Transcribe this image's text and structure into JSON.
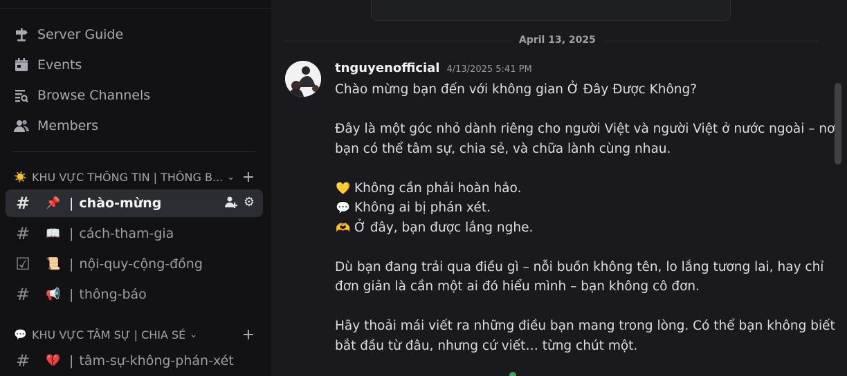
{
  "sidebar": {
    "nav": [
      {
        "label": "Server Guide",
        "icon": "signpost-icon"
      },
      {
        "label": "Events",
        "icon": "calendar-icon"
      },
      {
        "label": "Browse Channels",
        "icon": "browse-channels-icon"
      },
      {
        "label": "Members",
        "icon": "members-icon"
      }
    ],
    "categories": [
      {
        "emoji": "☀️",
        "title": "KHU VỰC THÔNG TIN | THÔNG B..."
      },
      {
        "emoji": "💬",
        "title": "KHU VỰC TÂM SỰ | CHIA SẺ"
      }
    ],
    "channels": [
      {
        "icon": "#",
        "emoji": "📌",
        "name": "chào-mừng",
        "active": true
      },
      {
        "icon": "#",
        "emoji": "📖",
        "name": "cách-tham-gia",
        "active": false
      },
      {
        "icon": "☑",
        "emoji": "📜",
        "name": "nội-quy-cộng-đồng",
        "active": false
      },
      {
        "icon": "#",
        "emoji": "📢",
        "name": "thông-báo",
        "active": false
      },
      {
        "icon": "#",
        "emoji": "💔",
        "name": "tâm-sự-không-phán-xét",
        "active": false
      }
    ]
  },
  "main": {
    "date_divider": "April 13, 2025",
    "message": {
      "username": "tnguyenofficial",
      "timestamp": "4/13/2025 5:41 PM",
      "lines": [
        "Chào mừng bạn đến với không gian Ở Đây Được Không?",
        "",
        "Đây là một góc nhỏ dành riêng cho người Việt và người Việt ở nước ngoài – nơi",
        "bạn có thể tâm sự, chia sẻ, và chữa lành cùng nhau.",
        "",
        "Không cần phải hoàn hảo.",
        "Không ai bị phán xét.",
        "Ở đây, bạn được lắng nghe.",
        "",
        "Dù bạn đang trải qua điều gì – nỗi buồn không tên, lo lắng tương lai, hay chỉ",
        "đơn giản là cần một ai đó hiểu mình – bạn không cô đơn.",
        "",
        "Hãy thoải mái viết ra những điều bạn mang trong lòng. Có thể bạn không biết",
        "bắt đầu từ đâu, nhưng cứ viết… từng chút một."
      ],
      "line_emojis": {
        "5": "💛",
        "6": "💬",
        "7": "🫶"
      }
    }
  },
  "colors": {
    "sidebar_bg": "#121214",
    "main_bg": "#1a1a1e",
    "active_bg": "#2c2d32"
  }
}
